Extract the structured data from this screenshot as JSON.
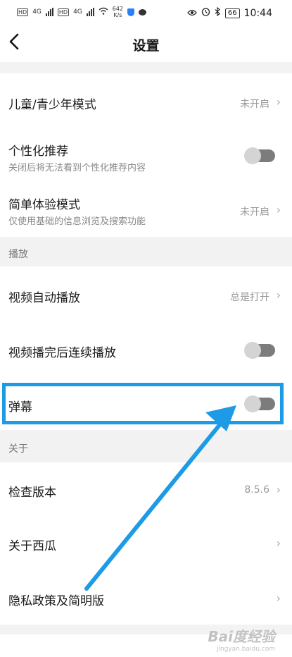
{
  "status_bar": {
    "left_badges": [
      "HD",
      "HD"
    ],
    "network": [
      "4G",
      "4G"
    ],
    "speed_value": "642",
    "speed_unit": "K/s",
    "battery": "66",
    "time": "10:44",
    "icons": [
      "eye-icon",
      "alarm-icon",
      "bluetooth-icon"
    ]
  },
  "header": {
    "back_icon": "chevron-left-icon",
    "title": "设置"
  },
  "rows": {
    "child_mode": {
      "label": "儿童/青少年模式",
      "value": "未开启"
    },
    "personalized": {
      "label": "个性化推荐",
      "sub": "关闭后将无法看到个性化推荐内容",
      "toggle_on": false
    },
    "simple_mode": {
      "label": "简单体验模式",
      "sub": "仅使用基础的信息浏览及搜索功能",
      "value": "未开启"
    },
    "video_autoplay": {
      "label": "视频自动播放",
      "value": "总是打开"
    },
    "continuous_play": {
      "label": "视频播完后连续播放",
      "toggle_on": false
    },
    "danmaku": {
      "label": "弹幕",
      "toggle_on": false
    },
    "check_version": {
      "label": "检查版本",
      "value": "8.5.6"
    },
    "about": {
      "label": "关于西瓜"
    },
    "privacy": {
      "label": "隐私政策及简明版"
    }
  },
  "sections": {
    "playback": "播放",
    "about": "关于"
  },
  "annotation": {
    "color": "#1e9be6"
  },
  "watermark": {
    "line1": "Bai度经验",
    "line2": "jingyan.baidu.com"
  }
}
